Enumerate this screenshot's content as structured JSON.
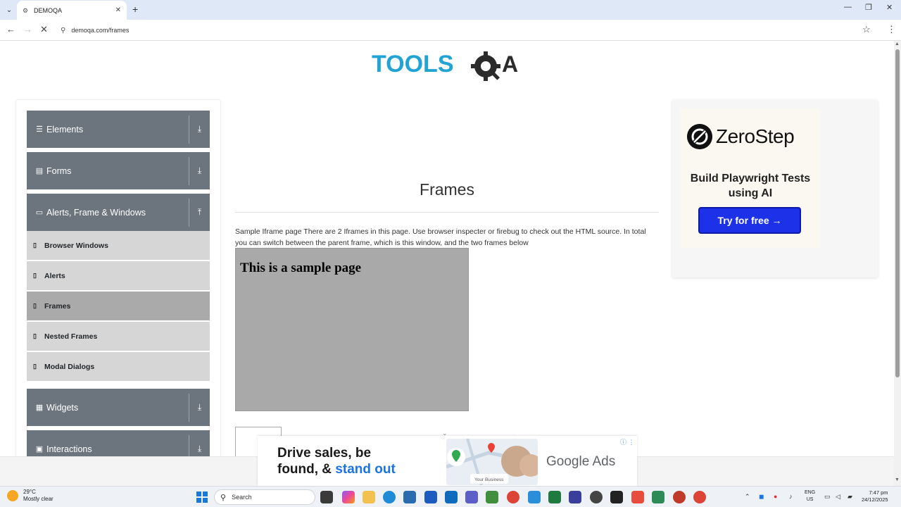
{
  "browser": {
    "tab_title": "DEMOQA",
    "url": "demoqa.com/frames",
    "new_tab_symbol": "+",
    "close_symbol": "✕"
  },
  "logo": {
    "text_tools": "TOOLS",
    "text_qa": "QA",
    "colors": {
      "tools": "#21a3d4",
      "qa": "#2b2b2b"
    }
  },
  "sidebar": {
    "groups": [
      {
        "label": "Elements",
        "icon": "hamburger-icon",
        "state": "collapsed"
      },
      {
        "label": "Forms",
        "icon": "form-icon",
        "state": "collapsed"
      },
      {
        "label": "Alerts, Frame & Windows",
        "icon": "window-icon",
        "state": "expanded"
      },
      {
        "label": "Widgets",
        "icon": "grid-icon",
        "state": "collapsed"
      },
      {
        "label": "Interactions",
        "icon": "interaction-icon",
        "state": "collapsed"
      }
    ],
    "sub_items": [
      {
        "label": "Browser Windows",
        "active": false
      },
      {
        "label": "Alerts",
        "active": false
      },
      {
        "label": "Frames",
        "active": true
      },
      {
        "label": "Nested Frames",
        "active": false
      },
      {
        "label": "Modal Dialogs",
        "active": false
      }
    ],
    "colors": {
      "group_bg": "#6c757d",
      "sub_bg": "#d6d6d6",
      "active_bg": "#aaaaaa"
    }
  },
  "main": {
    "title": "Frames",
    "intro": "Sample Iframe page There are 2 Iframes in this page. Use browser inspecter or firebug to check out the HTML source. In total you can switch between the parent frame, which is this window, and the two frames below",
    "frame1_heading": "This is a sample page"
  },
  "side_ad": {
    "brand": "ZeroStep",
    "headline": "Build Playwright Tests using AI",
    "button": "Try for free →",
    "button_color": "#1d32e8"
  },
  "bottom_ad": {
    "line1": "Drive sales, be",
    "line2_prefix": "found, & ",
    "line2_highlight": "stand out",
    "brand": "Google Ads",
    "map_label": "Your Business",
    "info_symbol": "ⓘ ⋮"
  },
  "taskbar": {
    "weather_temp": "29°C",
    "weather_desc": "Mostly clear",
    "search_placeholder": "Search",
    "lang_line1": "ENG",
    "lang_line2": "US",
    "time": "7:47 pm",
    "date": "24/12/2025"
  }
}
